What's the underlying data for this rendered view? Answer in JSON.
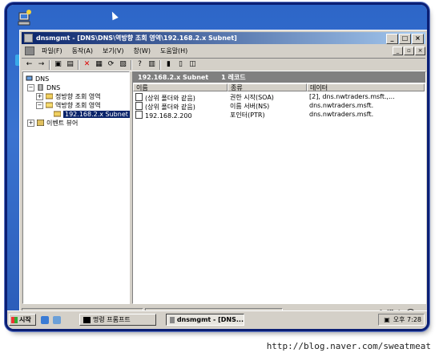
{
  "window": {
    "title": "dnsmgmt - [DNS\\DNS\\역방향 조회 영역\\192.168.2.x Subnet]",
    "minimize": "_",
    "maximize": "□",
    "close": "×"
  },
  "menubar": {
    "items": [
      {
        "label": "파일(F)"
      },
      {
        "label": "동작(A)"
      },
      {
        "label": "보기(V)"
      },
      {
        "label": "창(W)"
      },
      {
        "label": "도움말(H)"
      }
    ]
  },
  "toolbar": {
    "icons": [
      "back-arrow-icon",
      "forward-arrow-icon",
      "up-folder-icon",
      "console-tree-icon",
      "delete-icon",
      "properties-icon",
      "refresh-icon",
      "export-icon",
      "help-icon",
      "server-icon",
      "update-icon",
      "new-record-icon",
      "new-zone-icon",
      "new-domain-icon"
    ]
  },
  "tree": {
    "root": "DNS",
    "server": "DNS",
    "forward_zone": "정방향 조회 영역",
    "reverse_zone": "역방향 조회 영역",
    "subnet": "192.168.2.x Subnet",
    "event_viewer": "이벤트 뷰어"
  },
  "listpane": {
    "header_title": "192.168.2.x Subnet",
    "header_count": "1 레코드",
    "columns": [
      "이름",
      "종류",
      "데이터"
    ],
    "rows": [
      {
        "name": "(상위 폴더와 같음)",
        "type": "권한 시작(SOA)",
        "data": "[2], dns.nwtraders.msft.,..."
      },
      {
        "name": "(상위 폴더와 같음)",
        "type": "이름 서버(NS)",
        "data": "dns.nwtraders.msft."
      },
      {
        "name": "192.168.2.200",
        "type": "포인터(PTR)",
        "data": "dns.nwtraders.msft."
      }
    ]
  },
  "statusbar": {
    "ime_mode": "A",
    "ime_hanja": "漢"
  },
  "taskbar": {
    "start_label": "시작",
    "task1": "명령 프롬프트",
    "task2": "dnsmgmt - [DNS...",
    "clock": "오후 7:28"
  },
  "watermark": "http://blog.naver.com/sweatmeat",
  "colors": {
    "titlebar_start": "#0a246a",
    "titlebar_end": "#a6caf0",
    "selection": "#0a246a",
    "desktop": "#3a73d0"
  }
}
